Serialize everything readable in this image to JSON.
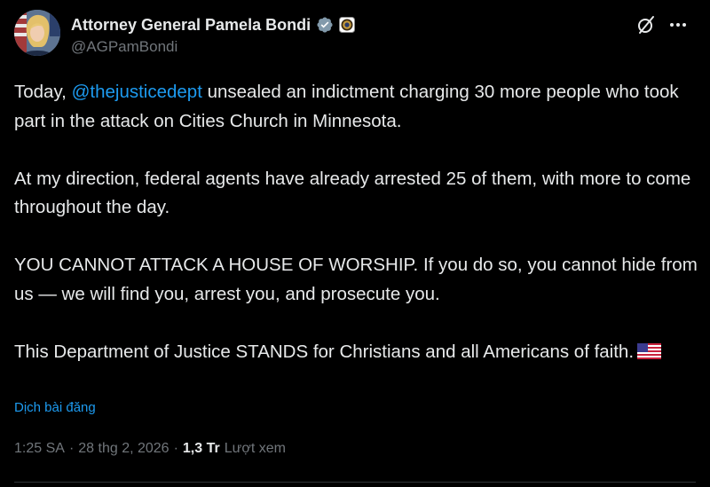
{
  "author": {
    "display_name": "Attorney General Pamela Bondi",
    "handle": "@AGPamBondi"
  },
  "tweet": {
    "p1_before": "Today, ",
    "p1_mention": "@thejusticedept",
    "p1_after": " unsealed an indictment charging 30 more people who took part in the attack on Cities Church in Minnesota.",
    "p2": "At my direction, federal agents have already arrested 25 of them, with more to come throughout the day.",
    "p3": "YOU CANNOT ATTACK A HOUSE OF WORSHIP. If you do so, you cannot hide from us — we will find you, arrest you, and prosecute you.",
    "p4": "This Department of Justice STANDS for Christians and all Americans of faith."
  },
  "translate_label": "Dịch bài đăng",
  "meta": {
    "time": "1:25 SA",
    "date": "28 thg 2, 2026",
    "views_count": "1,3 Tr",
    "views_label": "Lượt xem"
  },
  "icons": {
    "verified": "verified-badge-icon",
    "affiliation": "affiliation-badge-icon",
    "grok": "grok-icon",
    "more": "more-icon",
    "flag": "us-flag-icon"
  },
  "colors": {
    "background": "#000000",
    "text": "#e7e9ea",
    "secondary": "#71767b",
    "link": "#1d9bf0",
    "verified_badge": "#829aab"
  }
}
